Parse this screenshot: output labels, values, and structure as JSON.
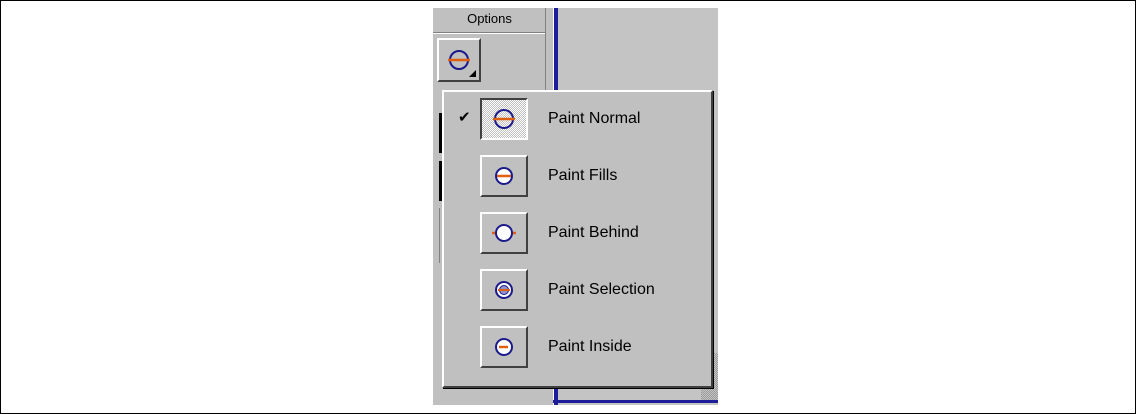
{
  "panel": {
    "options_title": "Options",
    "current_mode_icon": "paint-normal-icon"
  },
  "menu": {
    "checked_index": 0,
    "items": [
      {
        "label": "Paint Normal",
        "icon": "paint-normal-icon",
        "checked": true
      },
      {
        "label": "Paint Fills",
        "icon": "paint-fills-icon",
        "checked": false
      },
      {
        "label": "Paint Behind",
        "icon": "paint-behind-icon",
        "checked": false
      },
      {
        "label": "Paint Selection",
        "icon": "paint-selection-icon",
        "checked": false
      },
      {
        "label": "Paint Inside",
        "icon": "paint-inside-icon",
        "checked": false
      }
    ]
  },
  "colors": {
    "circle_stroke": "#1a1a8c",
    "brush_stroke": "#e06010",
    "canvas_border": "#1d1d9a"
  }
}
